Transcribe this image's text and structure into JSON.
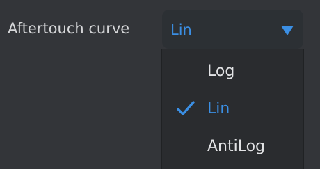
{
  "setting": {
    "label": "Aftertouch curve"
  },
  "select": {
    "value": "Lin",
    "arrow_icon": "triangle-down-icon",
    "accent_color": "#3b8fe4"
  },
  "menu": {
    "items": [
      {
        "label": "Log",
        "selected": false
      },
      {
        "label": "Lin",
        "selected": true,
        "icon": "checkmark-icon"
      },
      {
        "label": "AntiLog",
        "selected": false
      }
    ]
  },
  "colors": {
    "background": "#333539",
    "menu_background": "#2a2c2f",
    "accent": "#3b8fe4",
    "text": "#e2e3e5"
  }
}
